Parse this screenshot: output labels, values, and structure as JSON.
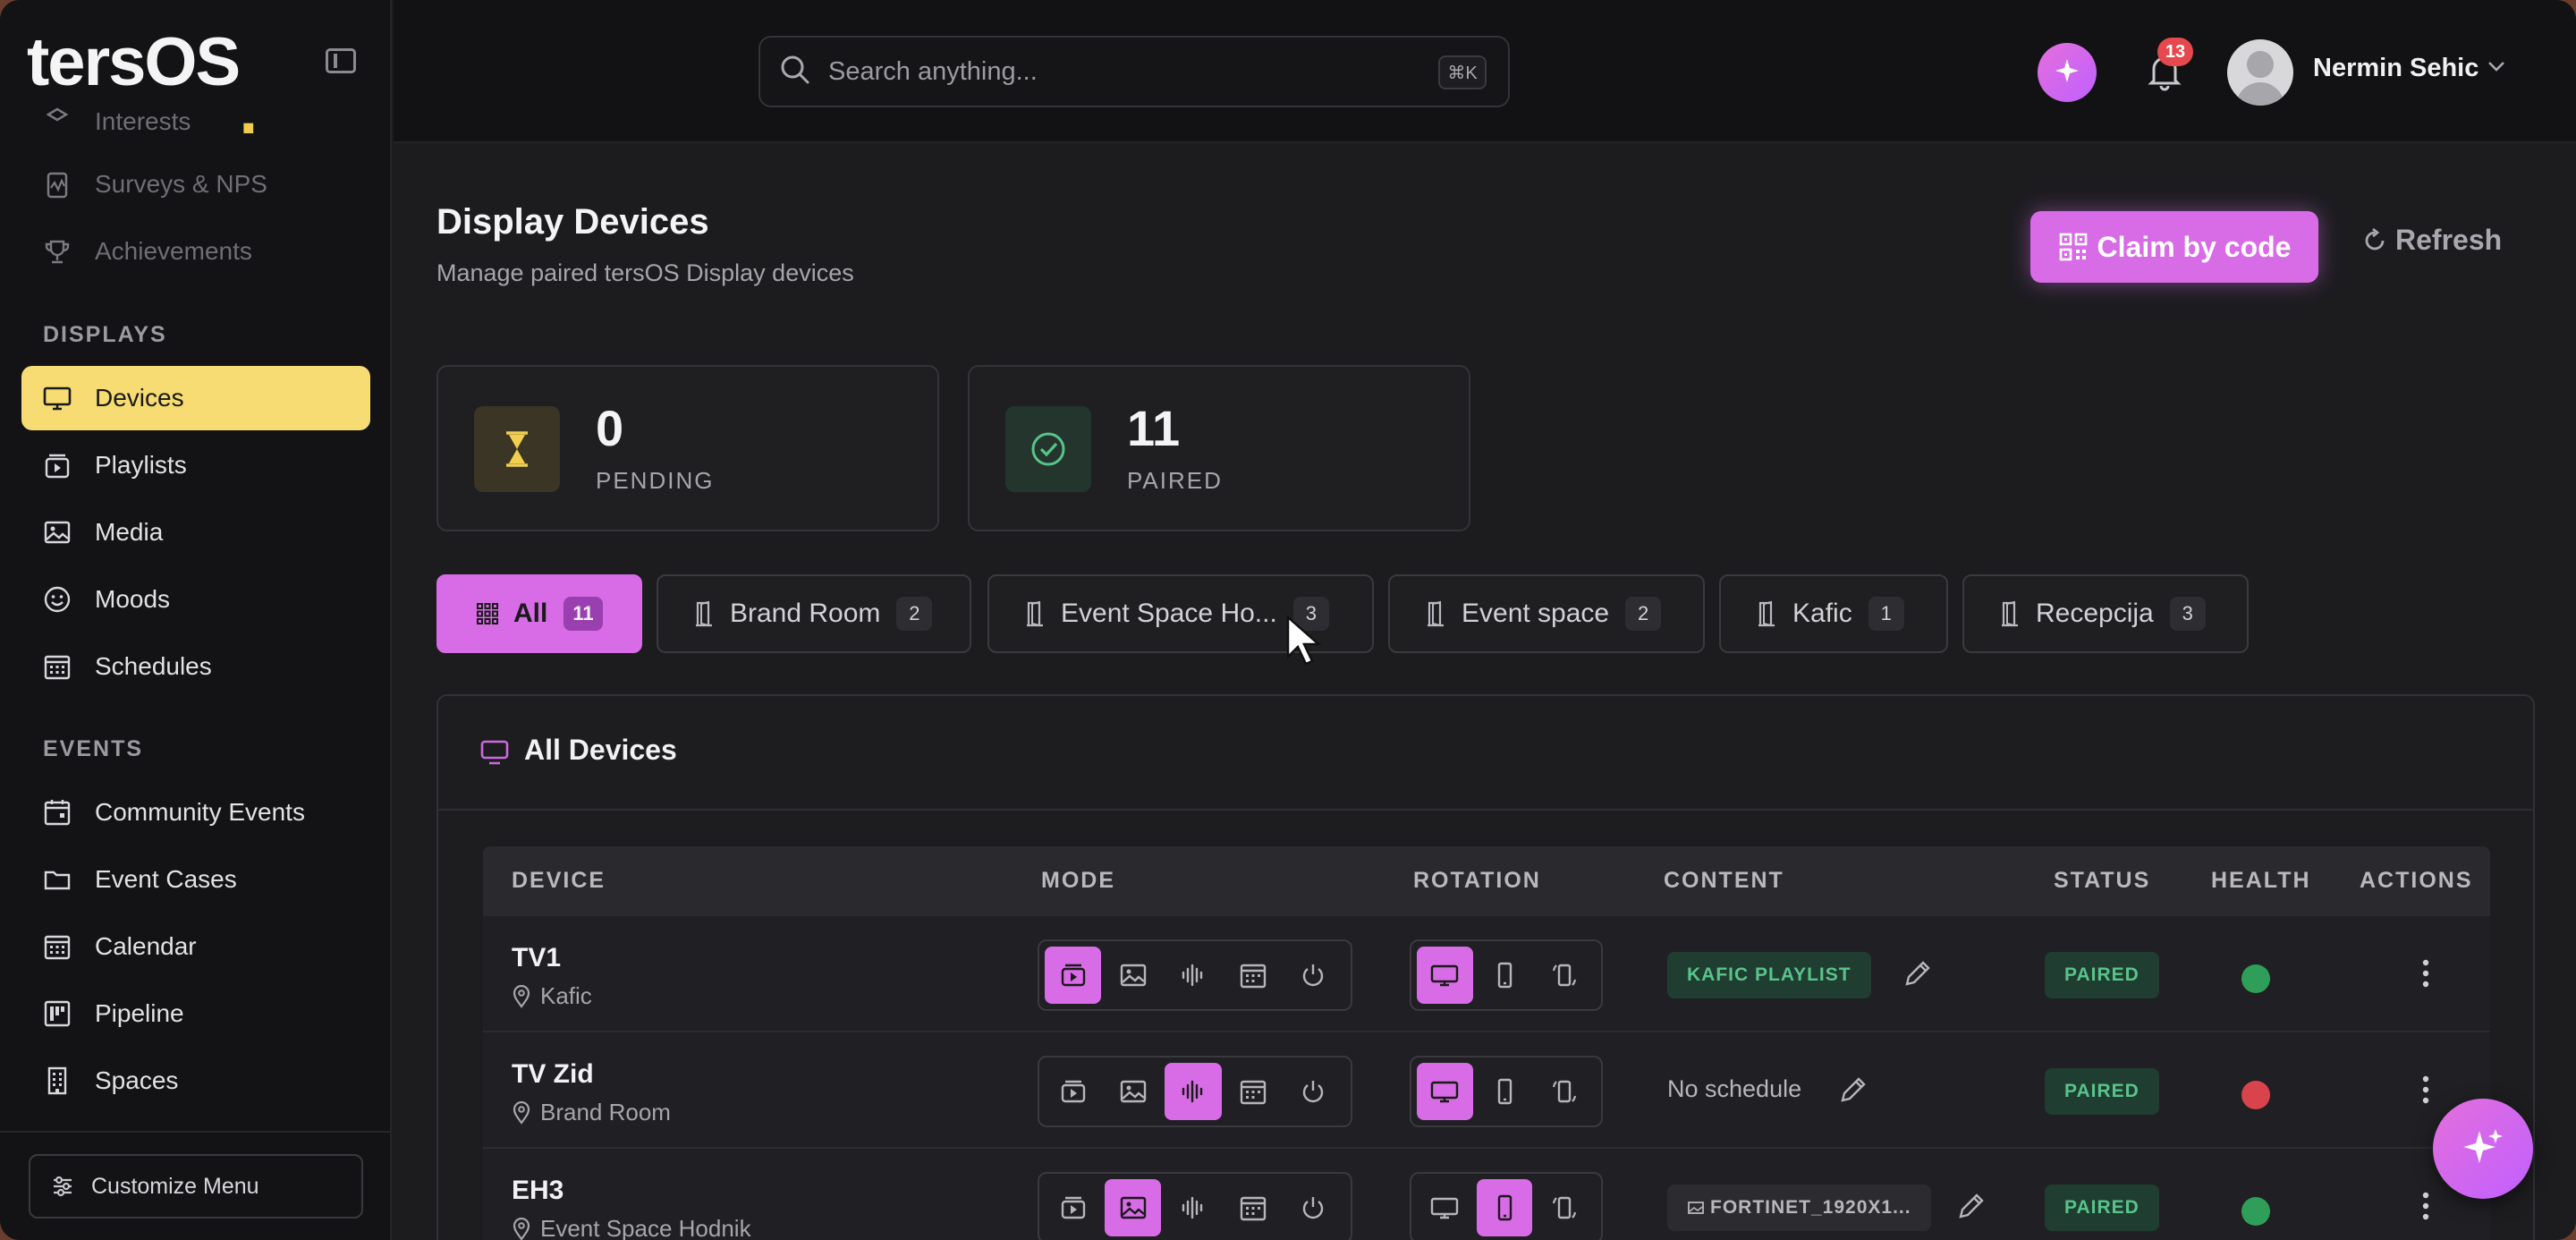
{
  "app": {
    "logo": "tersOS",
    "logo_dot": "."
  },
  "sidebar": {
    "top_items": [
      {
        "label": "Interests",
        "icon": "interests-icon"
      },
      {
        "label": "Surveys & NPS",
        "icon": "chart-icon"
      },
      {
        "label": "Achievements",
        "icon": "trophy-icon"
      }
    ],
    "displays_label": "DISPLAYS",
    "displays_items": [
      {
        "label": "Devices",
        "icon": "monitor-icon",
        "active": true
      },
      {
        "label": "Playlists",
        "icon": "playlist-icon"
      },
      {
        "label": "Media",
        "icon": "image-icon"
      },
      {
        "label": "Moods",
        "icon": "smile-icon"
      },
      {
        "label": "Schedules",
        "icon": "calendar-grid-icon"
      }
    ],
    "events_label": "EVENTS",
    "events_items": [
      {
        "label": "Community Events",
        "icon": "calendar-icon"
      },
      {
        "label": "Event Cases",
        "icon": "folder-icon"
      },
      {
        "label": "Calendar",
        "icon": "calendar-grid-icon"
      },
      {
        "label": "Pipeline",
        "icon": "kanban-icon"
      },
      {
        "label": "Spaces",
        "icon": "building-icon"
      }
    ],
    "customize_label": "Customize Menu"
  },
  "header": {
    "search_placeholder": "Search anything...",
    "search_shortcut": "⌘K",
    "notification_count": "13",
    "user_name": "Nermin Sehic"
  },
  "page": {
    "title": "Display Devices",
    "subtitle": "Manage paired tersOS Display devices",
    "claim_label": "Claim by code",
    "refresh_label": "Refresh"
  },
  "stats": [
    {
      "value": "0",
      "label": "PENDING"
    },
    {
      "value": "11",
      "label": "PAIRED"
    }
  ],
  "filters": [
    {
      "label": "All",
      "count": "11",
      "active": true
    },
    {
      "label": "Brand Room",
      "count": "2"
    },
    {
      "label": "Event Space Ho...",
      "count": "3"
    },
    {
      "label": "Event space",
      "count": "2"
    },
    {
      "label": "Kafic",
      "count": "1"
    },
    {
      "label": "Recepcija",
      "count": "3"
    }
  ],
  "table": {
    "title": "All Devices",
    "columns": [
      "DEVICE",
      "MODE",
      "ROTATION",
      "CONTENT",
      "STATUS",
      "HEALTH",
      "ACTIONS"
    ],
    "rows": [
      {
        "name": "TV1",
        "location": "Kafic",
        "mode_active": 0,
        "rotation_active": 0,
        "content": "KAFIC PLAYLIST",
        "content_type": "pill",
        "status": "PAIRED",
        "health": "#2f9e58"
      },
      {
        "name": "TV Zid",
        "location": "Brand Room",
        "mode_active": 2,
        "rotation_active": 0,
        "content": "No schedule",
        "content_type": "plain",
        "status": "PAIRED",
        "health": "#d9434b"
      },
      {
        "name": "EH3",
        "location": "Event Space Hodnik",
        "mode_active": 1,
        "rotation_active": 1,
        "content": "FORTINET_1920X1...",
        "content_type": "media",
        "status": "PAIRED",
        "health": "#2f9e58"
      }
    ]
  },
  "colors": {
    "accent": "#d86be6",
    "active_nav": "#f6dc73",
    "paired_green": "#58c48a"
  }
}
